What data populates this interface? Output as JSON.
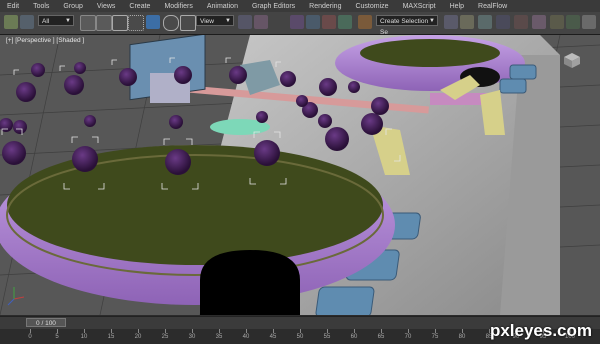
{
  "menu": [
    "Edit",
    "Tools",
    "Group",
    "Views",
    "Create",
    "Modifiers",
    "Animation",
    "Graph Editors",
    "Rendering",
    "Customize",
    "MAXScript",
    "Help",
    "RealFlow"
  ],
  "toolbar": {
    "filter_select": "All",
    "reference_select": "View",
    "selection_set": "Create Selection Se"
  },
  "viewport": {
    "label": "[+] [Perspective ] [Shaded ]"
  },
  "timeline": {
    "slider": "0 / 100",
    "ticks": [
      "0",
      "5",
      "10",
      "15",
      "20",
      "25",
      "30",
      "35",
      "40",
      "45",
      "50",
      "55",
      "60",
      "65",
      "70",
      "75",
      "80",
      "85",
      "90",
      "95",
      "100"
    ]
  },
  "watermark": "pxleyes.com",
  "colors": {
    "bg": "#5a5a5a",
    "platter_purple": "#b48bd6",
    "felt_green": "#3f4a1c",
    "berry_purple": "#3a1850",
    "button_blue": "#5f8cb0"
  }
}
